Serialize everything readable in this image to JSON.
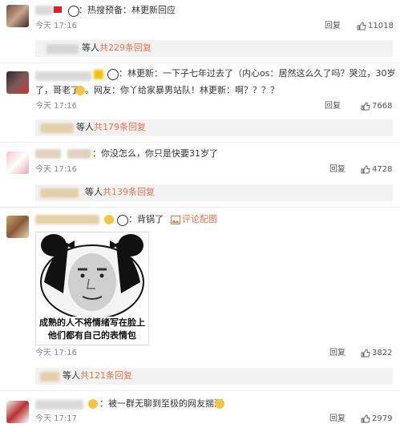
{
  "comments": [
    {
      "text": "：热搜预备：林更新回应",
      "time": "今天 17:16",
      "reply_label": "回复",
      "like_count": "11018",
      "sub": {
        "suffix": "等人",
        "count_text": "共229条回复"
      }
    },
    {
      "text_line1": "：林更新：一下子七年过去了（内心os：居然这么久了吗？哭泣，30岁",
      "text_line2": "了，哥老了",
      "text_line2b": "。网友：你丫给家暴男站队！林更新：啊？？？？",
      "time": "今天 17:16",
      "reply_label": "回复",
      "like_count": "7668",
      "sub": {
        "suffix": "等人",
        "count_text": "共179条回复"
      }
    },
    {
      "text": "：你没怎么，你只是快要31岁了",
      "time": "今天 17:16",
      "reply_label": "回复",
      "like_count": "4728",
      "sub": {
        "suffix": "等人",
        "count_text": "共139条回复"
      }
    },
    {
      "text": "：背锅了",
      "image_link": "评论配图",
      "meme_caption_1": "成熟的人不将情绪写在脸上",
      "meme_caption_2": "他们都有自己的表情包",
      "time": "今天 17:16",
      "reply_label": "回复",
      "like_count": "3822",
      "sub": {
        "suffix": "等人",
        "count_text": "共121条回复"
      }
    },
    {
      "text": "：被一群无聊到至极的网友揣测",
      "time": "今天 17:17",
      "reply_label": "回复",
      "like_count": "2979"
    }
  ],
  "colors": {
    "accent": "#eb7350",
    "reply_bg": "#f2f2f2"
  },
  "icons": [
    "thumbs-up-icon",
    "panda-emoji-icon",
    "image-icon"
  ]
}
